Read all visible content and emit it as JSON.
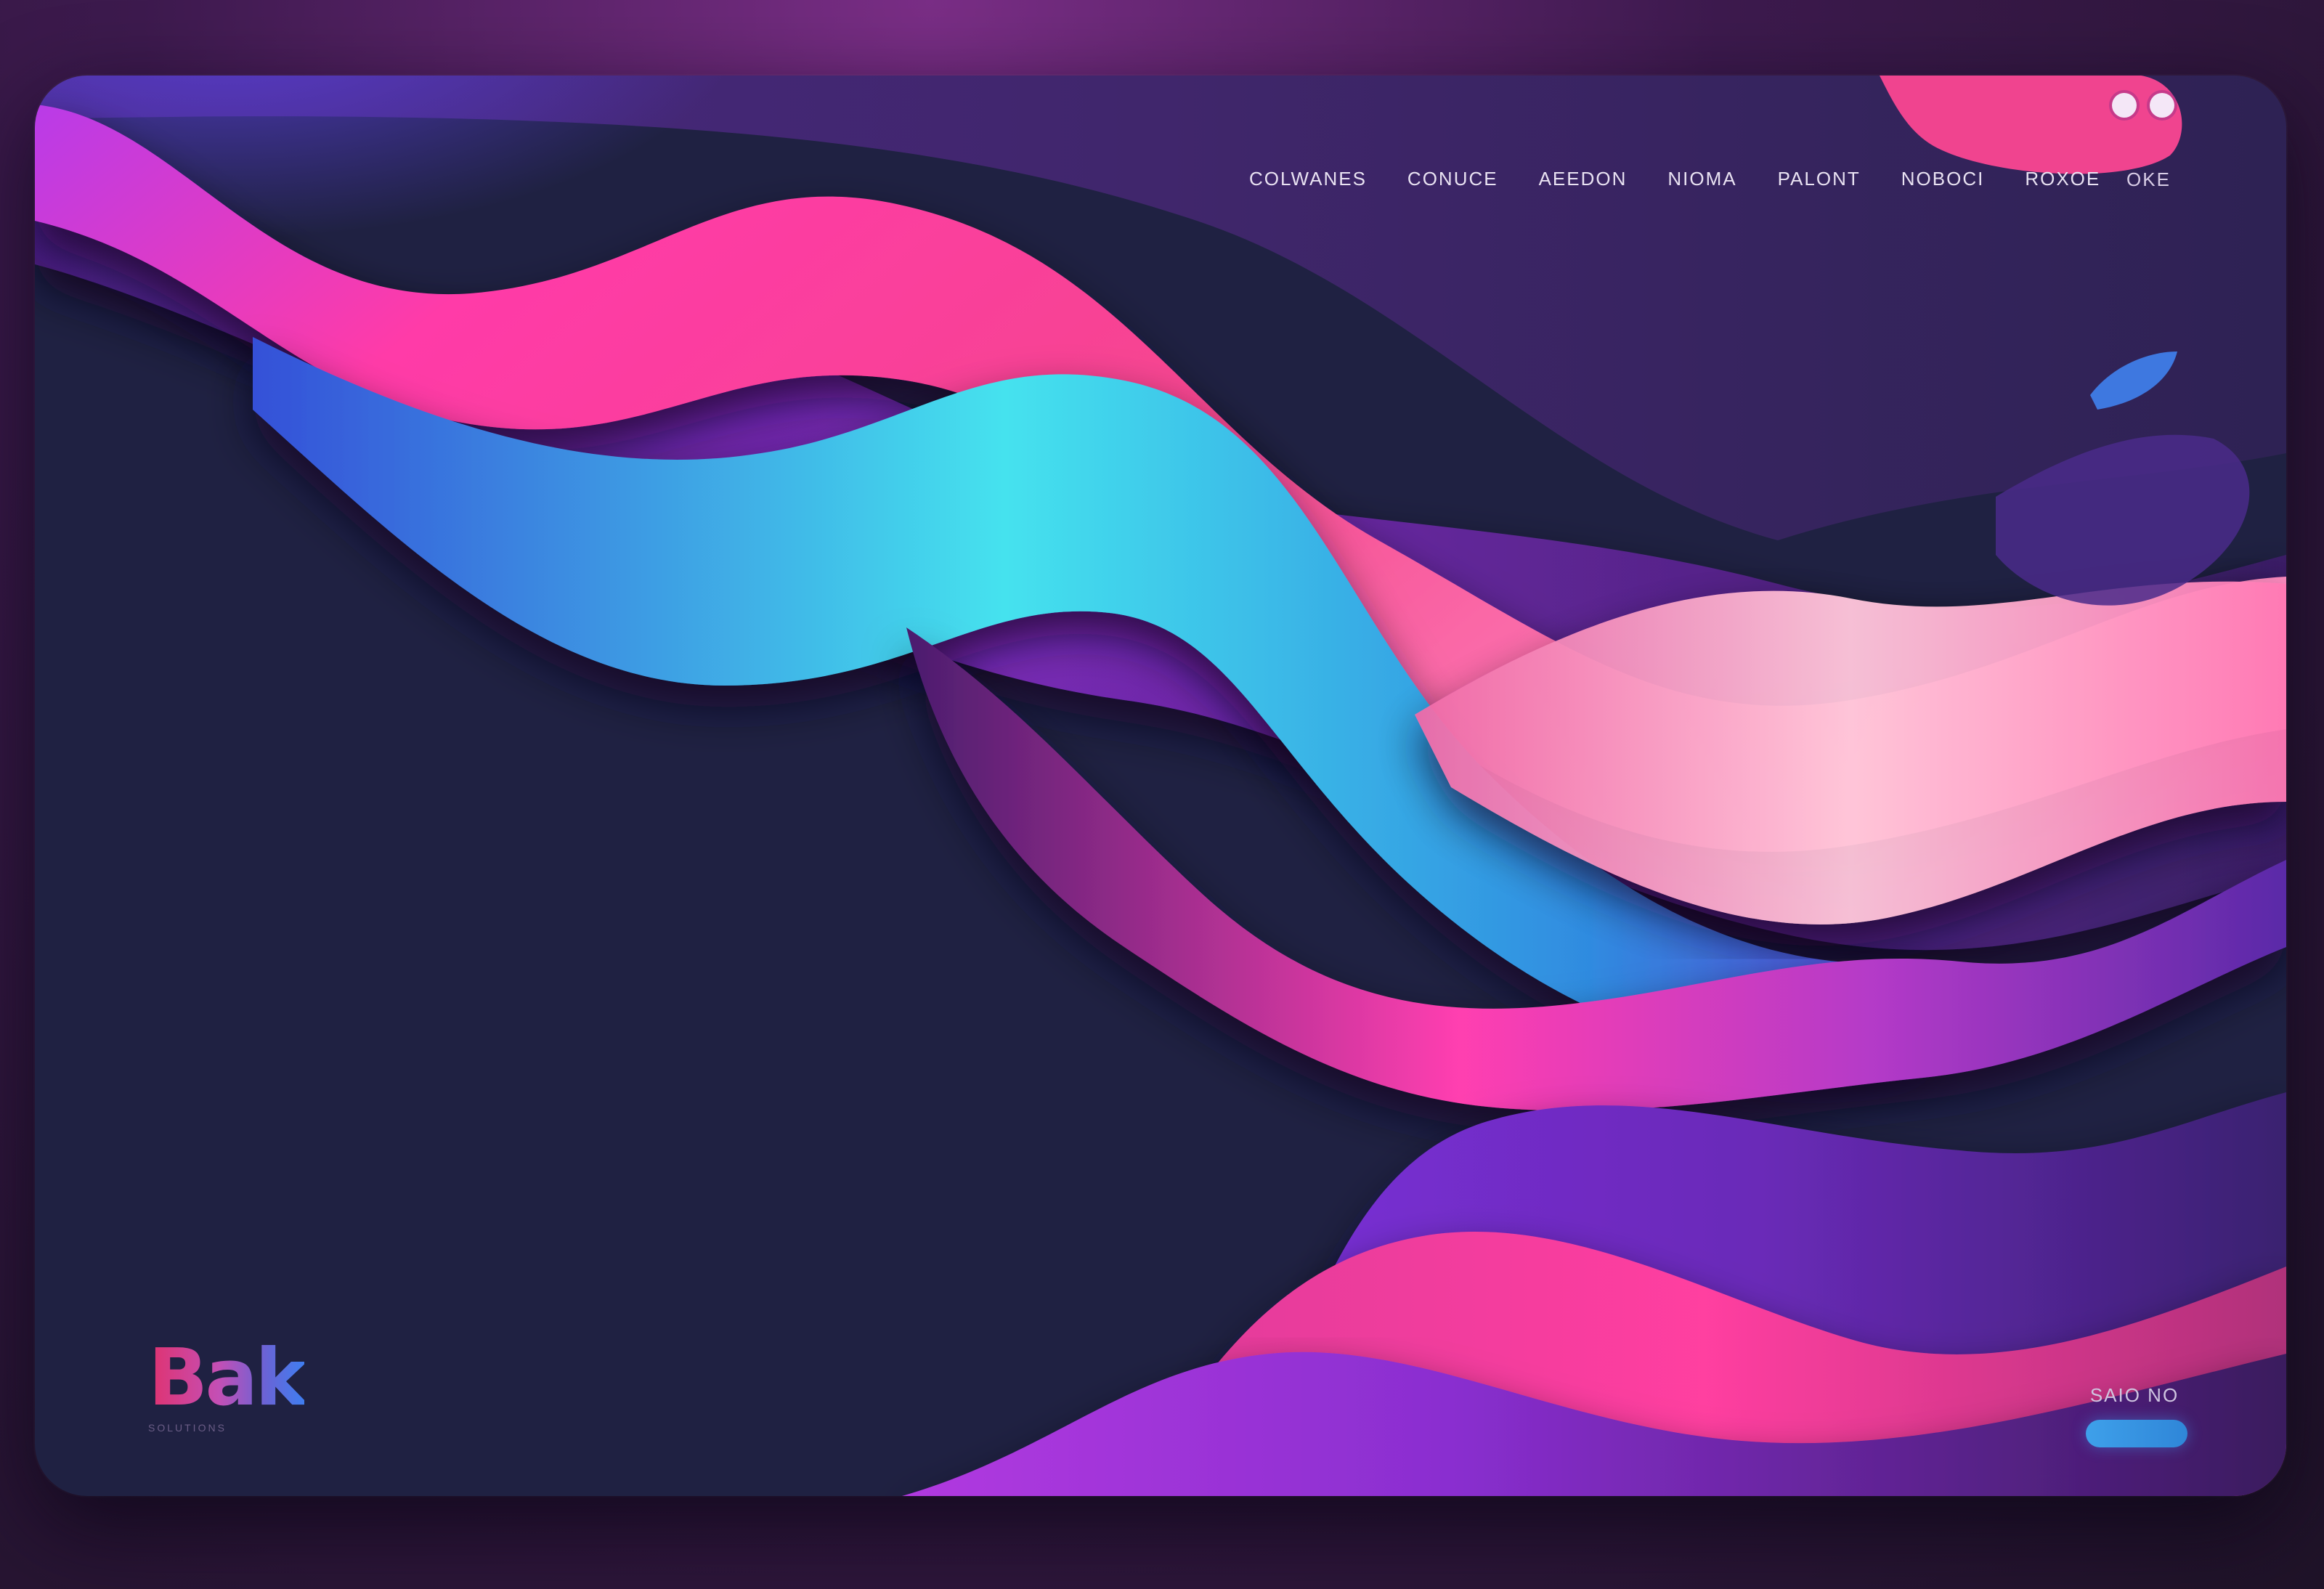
{
  "window": {
    "controls": [
      "window-dot",
      "window-dot"
    ]
  },
  "nav": {
    "items": [
      "COLWANES",
      "CONUCE",
      "AEEDON",
      "NIOMA",
      "PALONT",
      "NOBOCI",
      "ROXOE"
    ],
    "extra": "OKE"
  },
  "logo": {
    "mark": "Bak",
    "tagline": "SOLUTIONS"
  },
  "cta": {
    "label": "SAIO NO"
  },
  "colors": {
    "background": "#1f2142",
    "pink": "#f23b9a",
    "purple": "#8a2fd0",
    "cyan": "#3fd7ea",
    "blue": "#3e78e0",
    "cta": "#3ea0ea"
  }
}
